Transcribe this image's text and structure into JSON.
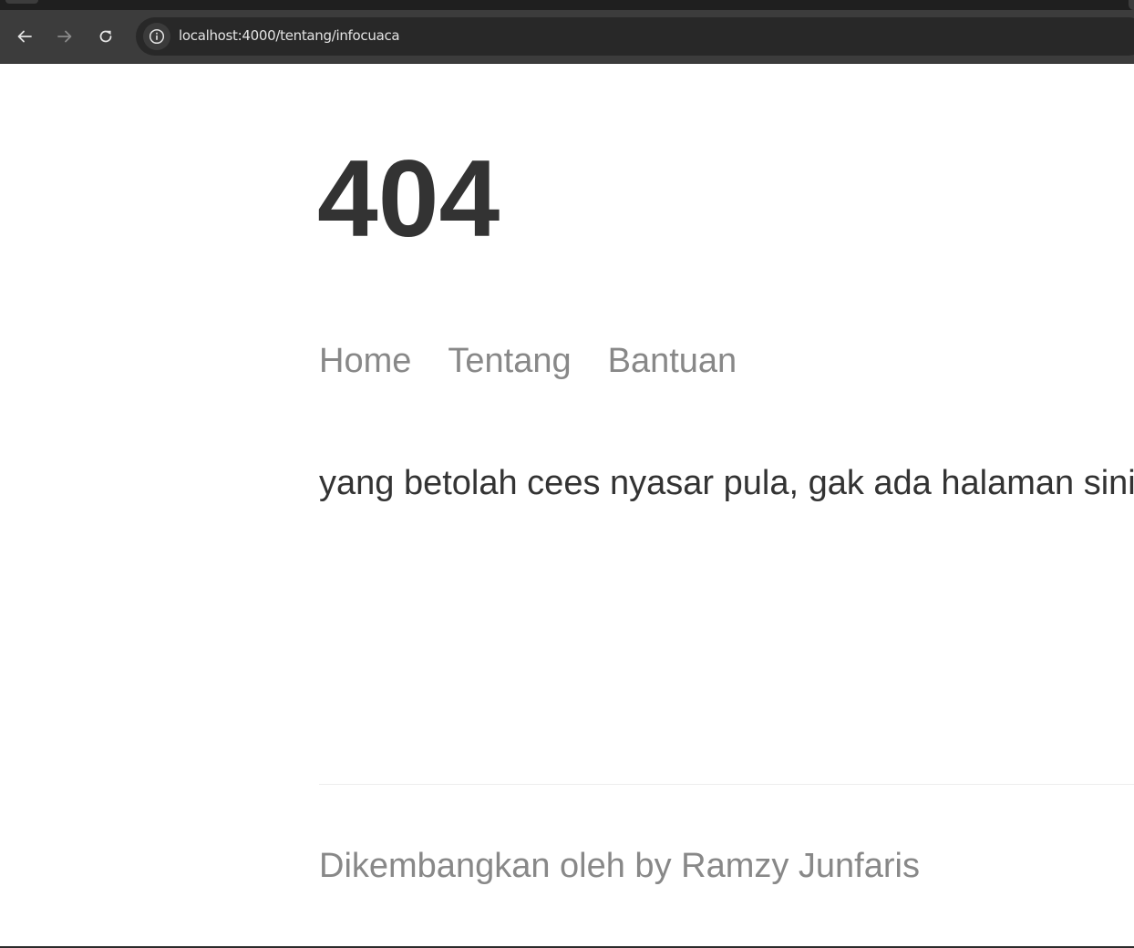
{
  "browser": {
    "url": "localhost:4000/tentang/infocuaca",
    "back_icon": "arrow-left-icon",
    "forward_icon": "arrow-right-icon",
    "reload_icon": "reload-icon",
    "site_info_icon": "info-icon"
  },
  "page": {
    "title": "404",
    "nav": [
      {
        "label": "Home"
      },
      {
        "label": "Tentang"
      },
      {
        "label": "Bantuan"
      }
    ],
    "message": "yang betolah cees nyasar pula, gak ada halaman sini.",
    "footer": "Dikembangkan oleh by Ramzy Junfaris"
  },
  "colors": {
    "chrome_bg": "#3c3c3c",
    "omnibox_bg": "#282828",
    "heading": "#333333",
    "muted_text": "#888888"
  }
}
